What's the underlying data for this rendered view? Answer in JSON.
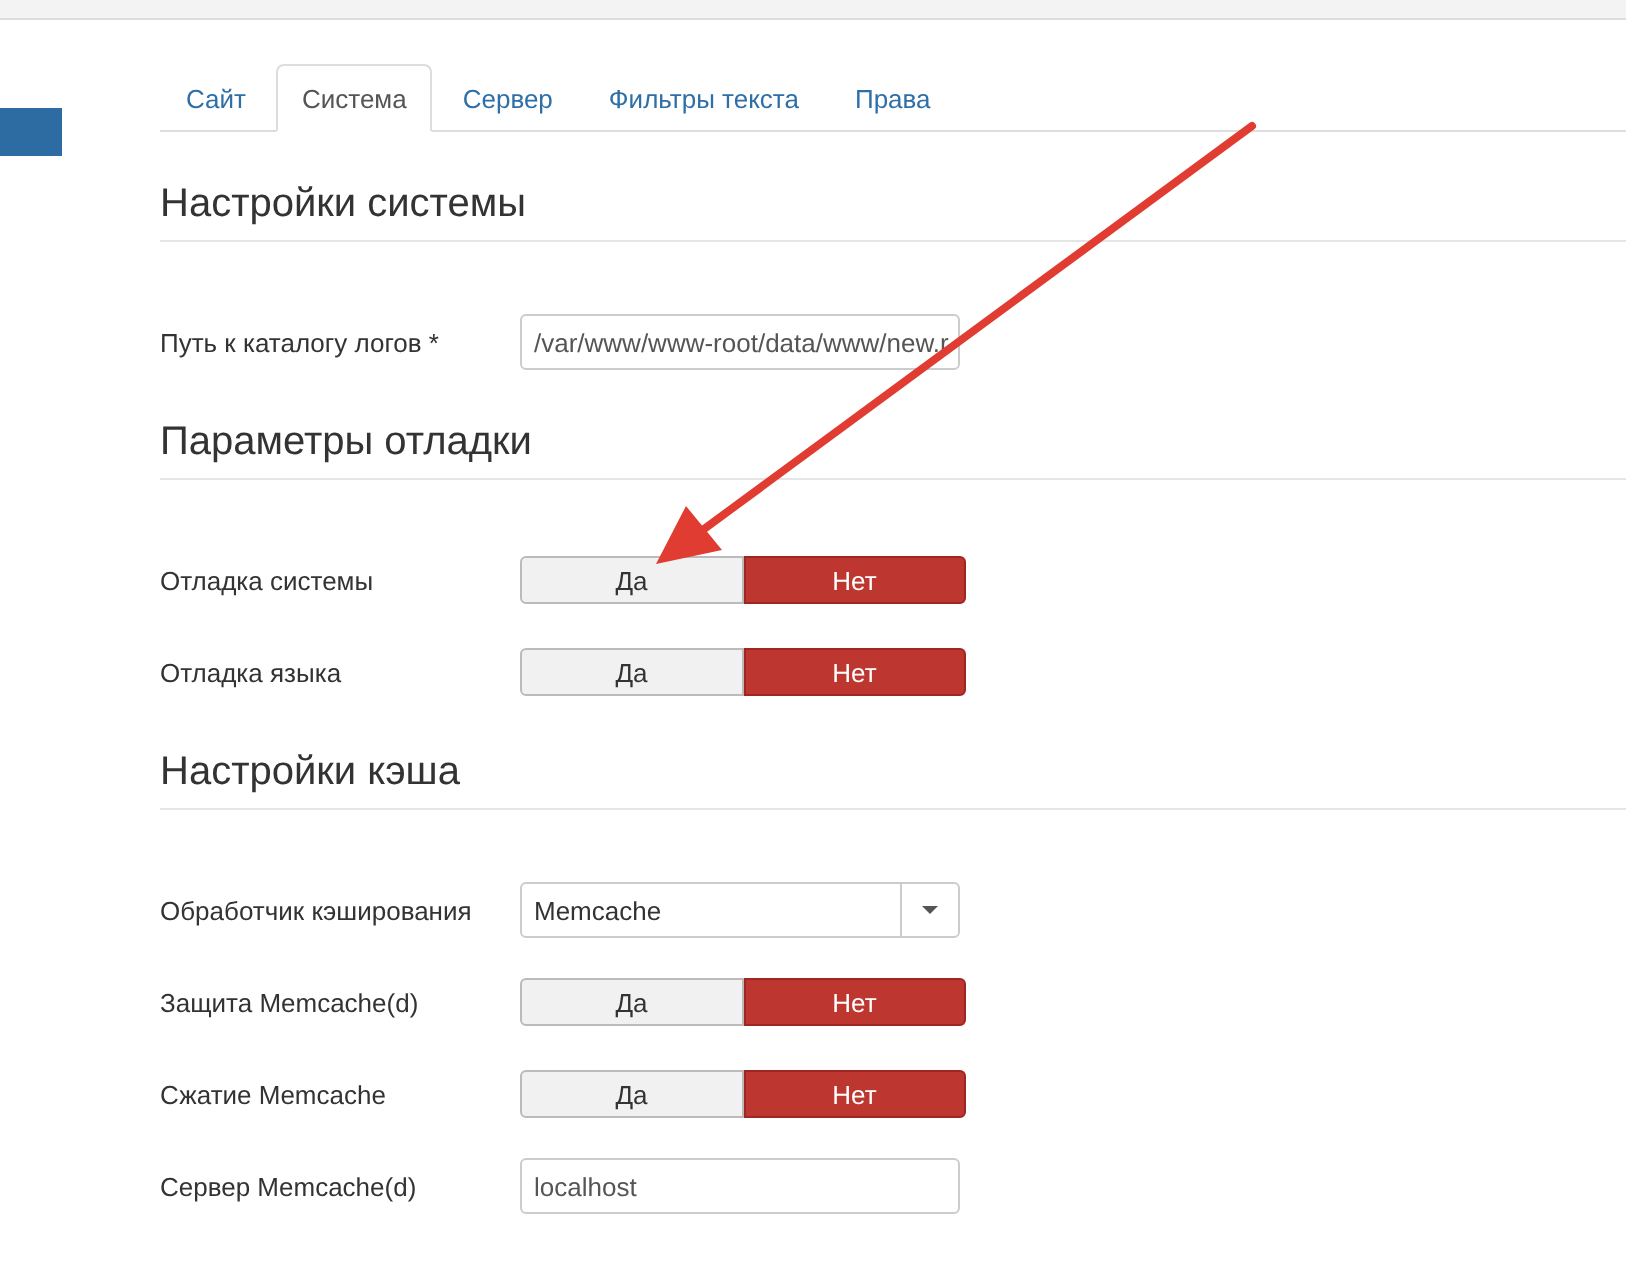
{
  "tabs": [
    {
      "label": "Сайт",
      "selected": false
    },
    {
      "label": "Система",
      "selected": true
    },
    {
      "label": "Сервер",
      "selected": false
    },
    {
      "label": "Фильтры текста",
      "selected": false
    },
    {
      "label": "Права",
      "selected": false
    }
  ],
  "sections": [
    {
      "title": "Настройки системы",
      "rows": [
        {
          "kind": "text",
          "label": "Путь к каталогу логов *",
          "value": "/var/www/www-root/data/www/new.r"
        }
      ]
    },
    {
      "title": "Параметры отладки",
      "rows": [
        {
          "kind": "toggle",
          "label": "Отладка системы",
          "options": [
            {
              "label": "Да",
              "selected": false
            },
            {
              "label": "Нет",
              "selected": true
            }
          ]
        },
        {
          "kind": "toggle",
          "label": "Отладка языка",
          "options": [
            {
              "label": "Да",
              "selected": false
            },
            {
              "label": "Нет",
              "selected": true
            }
          ]
        }
      ]
    },
    {
      "title": "Настройки кэша",
      "rows": [
        {
          "kind": "select",
          "label": "Обработчик кэширования",
          "value": "Memcache"
        },
        {
          "kind": "toggle",
          "label": "Защита Memcache(d)",
          "options": [
            {
              "label": "Да",
              "selected": false
            },
            {
              "label": "Нет",
              "selected": true
            }
          ]
        },
        {
          "kind": "toggle",
          "label": "Сжатие Memcache",
          "options": [
            {
              "label": "Да",
              "selected": false
            },
            {
              "label": "Нет",
              "selected": true
            }
          ]
        },
        {
          "kind": "text",
          "label": "Сервер Memcache(d)",
          "value": "localhost"
        }
      ]
    }
  ]
}
